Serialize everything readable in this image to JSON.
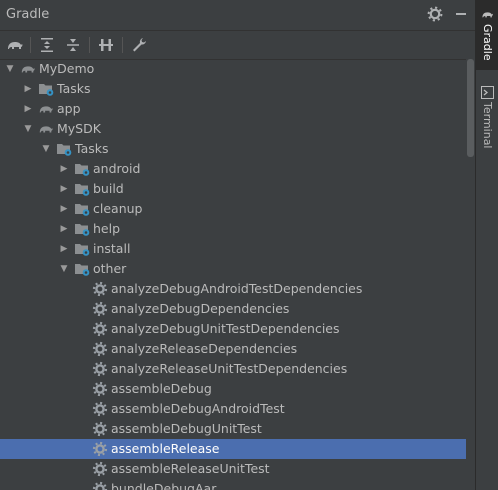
{
  "panel": {
    "title": "Gradle"
  },
  "colors": {
    "selection": "#4b6eaf",
    "task_icon": "#9aa0a6",
    "folder": "#8c8f91",
    "badge": "#3592c4"
  },
  "titlebar_icons": [
    "gear-icon",
    "minimize-icon"
  ],
  "toolbar": [
    "gradle-elephant-icon",
    "expand-all-icon",
    "collapse-all-icon",
    "link-projects-icon",
    "wrench-icon"
  ],
  "tree": [
    {
      "label": "MyDemo",
      "icon": "elephant",
      "depth": 0,
      "expanded": true
    },
    {
      "label": "Tasks",
      "icon": "folder",
      "depth": 1,
      "expanded": false
    },
    {
      "label": "app",
      "icon": "elephant",
      "depth": 1,
      "expanded": false
    },
    {
      "label": "MySDK",
      "icon": "elephant",
      "depth": 1,
      "expanded": true
    },
    {
      "label": "Tasks",
      "icon": "folder",
      "depth": 2,
      "expanded": true
    },
    {
      "label": "android",
      "icon": "folder",
      "depth": 3,
      "expanded": false
    },
    {
      "label": "build",
      "icon": "folder",
      "depth": 3,
      "expanded": false
    },
    {
      "label": "cleanup",
      "icon": "folder",
      "depth": 3,
      "expanded": false
    },
    {
      "label": "help",
      "icon": "folder",
      "depth": 3,
      "expanded": false
    },
    {
      "label": "install",
      "icon": "folder",
      "depth": 3,
      "expanded": false
    },
    {
      "label": "other",
      "icon": "folder",
      "depth": 3,
      "expanded": true
    },
    {
      "label": "analyzeDebugAndroidTestDependencies",
      "icon": "gear",
      "depth": 4
    },
    {
      "label": "analyzeDebugDependencies",
      "icon": "gear",
      "depth": 4
    },
    {
      "label": "analyzeDebugUnitTestDependencies",
      "icon": "gear",
      "depth": 4
    },
    {
      "label": "analyzeReleaseDependencies",
      "icon": "gear",
      "depth": 4
    },
    {
      "label": "analyzeReleaseUnitTestDependencies",
      "icon": "gear",
      "depth": 4
    },
    {
      "label": "assembleDebug",
      "icon": "gear",
      "depth": 4
    },
    {
      "label": "assembleDebugAndroidTest",
      "icon": "gear",
      "depth": 4
    },
    {
      "label": "assembleDebugUnitTest",
      "icon": "gear",
      "depth": 4
    },
    {
      "label": "assembleRelease",
      "icon": "gear",
      "depth": 4,
      "selected": true
    },
    {
      "label": "assembleReleaseUnitTest",
      "icon": "gear",
      "depth": 4
    },
    {
      "label": "bundleDebugAar",
      "icon": "gear",
      "depth": 4
    }
  ],
  "side_tabs": [
    {
      "label": "Gradle",
      "active": true
    },
    {
      "label": "Terminal",
      "active": false
    }
  ]
}
